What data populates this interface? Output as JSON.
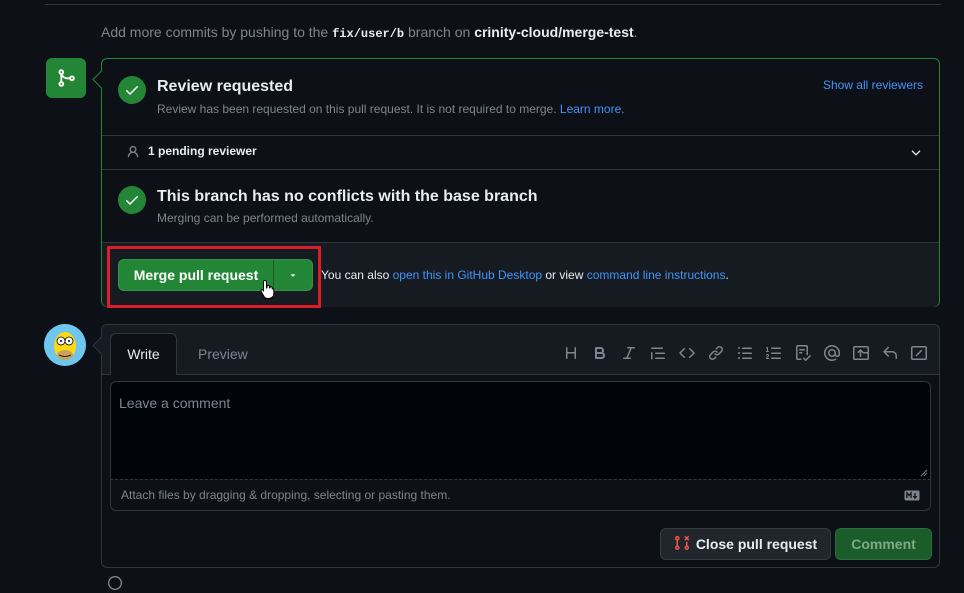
{
  "hint": {
    "prefix": "Add more commits by pushing to the ",
    "branch": "fix/user/b",
    "middle": " branch on ",
    "repo": "crinity-cloud/merge-test",
    "suffix": "."
  },
  "review": {
    "title": "Review requested",
    "subtitle": "Review has been requested on this pull request. It is not required to merge.",
    "learn_more": "Learn more.",
    "show_all": "Show all reviewers",
    "pending": "1 pending reviewer"
  },
  "conflicts": {
    "title": "This branch has no conflicts with the base branch",
    "subtitle": "Merging can be performed automatically."
  },
  "merge": {
    "button_label": "Merge pull request",
    "also_prefix": "You can also ",
    "desktop_link": "open this in GitHub Desktop",
    "or_view": " or view ",
    "cli_link": "command line instructions",
    "suffix": "."
  },
  "comment": {
    "tab_write": "Write",
    "tab_preview": "Preview",
    "placeholder": "Leave a comment",
    "attach_hint": "Attach files by dragging & dropping, selecting or pasting them.",
    "close_button": "Close pull request",
    "comment_button": "Comment"
  },
  "toolbar_icons": [
    "heading-icon",
    "bold-icon",
    "italic-icon",
    "quote-icon",
    "code-icon",
    "link-icon",
    "unordered-list-icon",
    "ordered-list-icon",
    "task-list-icon",
    "mention-icon",
    "reference-icon",
    "reply-icon",
    "fullscreen-icon"
  ],
  "colors": {
    "accent_green": "#238636",
    "link_blue": "#4493f8",
    "highlight_red": "#da1e28"
  }
}
